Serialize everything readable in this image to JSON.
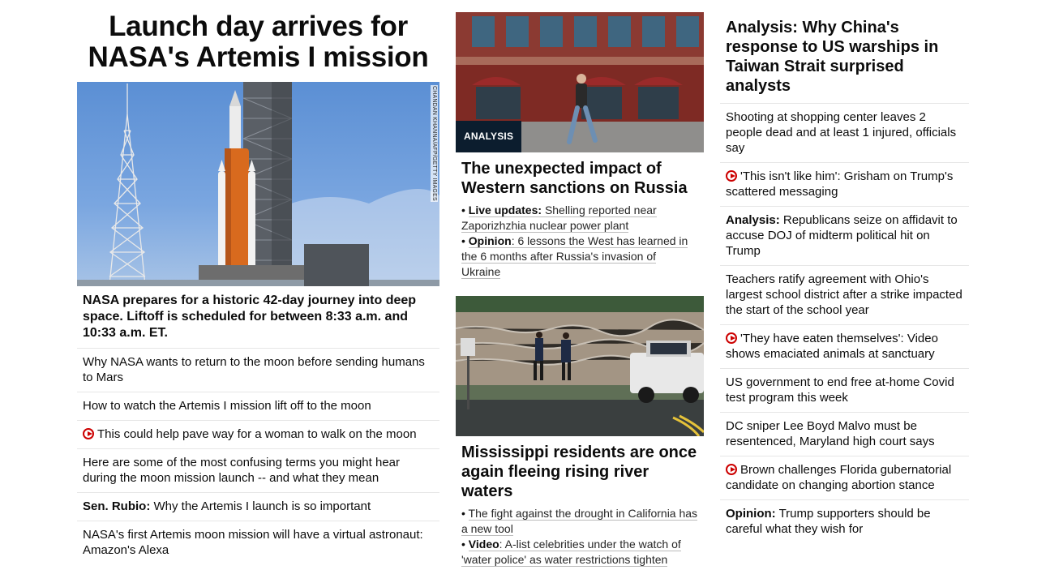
{
  "col1": {
    "main_title": "Launch day arrives for NASA's Artemis I mission",
    "hero_credit": "CHANDAN KHANNA/AFP/GETTY IMAGES",
    "hero_caption": "NASA prepares for a historic 42-day journey into deep space. Liftoff is scheduled for between 8:33 a.m. and 10:33 a.m. ET.",
    "items": [
      {
        "text": "Why NASA wants to return to the moon before sending humans to Mars"
      },
      {
        "text": "How to watch the Artemis I mission lift off to the moon"
      },
      {
        "text": "This could help pave way for a woman to walk on the moon",
        "icon": "play-video-icon"
      },
      {
        "text": "Here are some of the most confusing terms you might hear during the moon mission launch -- and what they mean"
      },
      {
        "lead": "Sen. Rubio:",
        "text": "Why the Artemis I launch is so important"
      },
      {
        "text": "NASA's first Artemis moon mission will have a virtual astronaut: Amazon's Alexa"
      }
    ]
  },
  "col2": {
    "story1": {
      "badge": "ANALYSIS",
      "title": "The unexpected impact of Western sanctions on Russia",
      "links": [
        {
          "lead": "Live updates:",
          "text": "Shelling reported near Zaporizhzhia nuclear power plant"
        },
        {
          "lead": "Opinion",
          "text": ": 6 lessons the West has learned in the 6 months after Russia's invasion of Ukraine"
        }
      ]
    },
    "story2": {
      "title": "Mississippi residents are once again fleeing rising river waters",
      "links": [
        {
          "text": "The fight against the drought in California has a new tool"
        },
        {
          "lead": "Video",
          "text": ": A-list celebrities under the watch of 'water police' as water restrictions tighten"
        }
      ]
    }
  },
  "col3": {
    "title": "Analysis: Why China's response to US warships in Taiwan Strait surprised analysts",
    "items": [
      {
        "text": "Shooting at shopping center leaves 2 people dead and at least 1 injured, officials say"
      },
      {
        "text": "'This isn't like him': Grisham on Trump's scattered messaging",
        "icon": "play-video-icon"
      },
      {
        "lead": "Analysis:",
        "text": "Republicans seize on affidavit to accuse DOJ of midterm political hit on Trump"
      },
      {
        "text": "Teachers ratify agreement with Ohio's largest school district after a strike impacted the start of the school year"
      },
      {
        "text": "'They have eaten themselves': Video shows emaciated animals at sanctuary",
        "icon": "play-video-icon"
      },
      {
        "text": "US government to end free at-home Covid test program this week"
      },
      {
        "text": "DC sniper Lee Boyd Malvo must be resentenced, Maryland high court says"
      },
      {
        "text": "Brown challenges Florida gubernatorial candidate on changing abortion stance",
        "icon": "play-video-icon"
      },
      {
        "lead": "Opinion:",
        "text": "Trump supporters should be careful what they wish for"
      }
    ]
  }
}
